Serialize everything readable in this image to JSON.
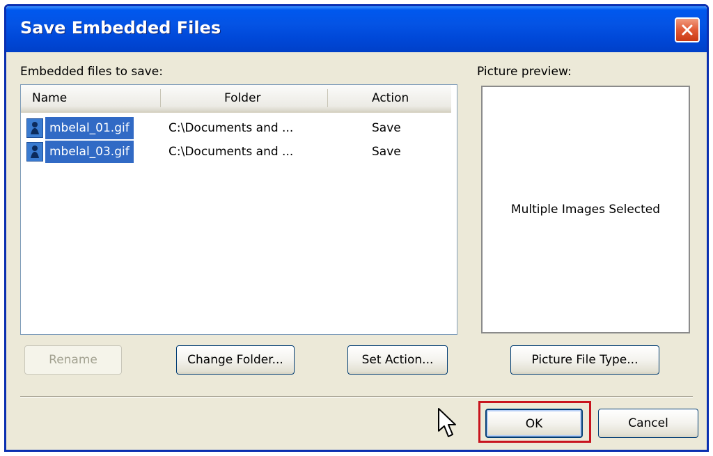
{
  "dialog": {
    "title": "Save Embedded Files"
  },
  "embedded_label": "Embedded files to save:",
  "preview_label": "Picture preview:",
  "table": {
    "columns": [
      "Name",
      "Folder",
      "Action"
    ],
    "rows": [
      {
        "name": "mbelal_01.gif",
        "folder": "C:\\Documents and ...",
        "action": "Save"
      },
      {
        "name": "mbelal_03.gif",
        "folder": "C:\\Documents and ...",
        "action": "Save"
      }
    ]
  },
  "preview": {
    "text": "Multiple Images Selected"
  },
  "buttons": {
    "rename": "Rename",
    "change_folder": "Change Folder...",
    "set_action": "Set Action...",
    "picture_file_type": "Picture File Type...",
    "ok": "OK",
    "cancel": "Cancel"
  },
  "colors": {
    "titlebar": "#0453e4",
    "dialog_bg": "#ece9d8",
    "selection": "#316ac5",
    "highlight_box": "#c8141e"
  }
}
